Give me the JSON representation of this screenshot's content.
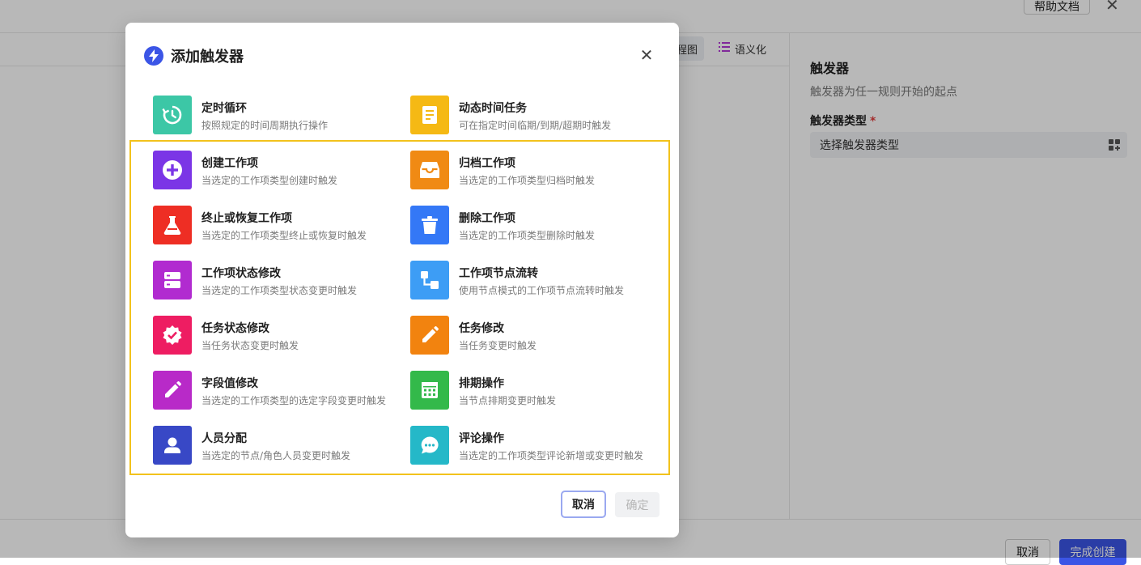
{
  "background": {
    "help_label": "帮助文档",
    "close_glyph": "✕",
    "tab_flow_label": "程图",
    "tab_semantic_label": "语义化",
    "panel": {
      "title": "触发器",
      "description": "触发器为任一规则开始的起点",
      "type_label": "触发器类型",
      "required_mark": "*",
      "type_placeholder": "选择触发器类型"
    },
    "footer": {
      "cancel_label": "取消",
      "finish_label": "完成创建"
    }
  },
  "modal": {
    "title": "添加触发器",
    "close_glyph": "✕",
    "triggers": [
      {
        "title": "定时循环",
        "desc": "按照规定的时间周期执行操作",
        "color": "#3cc7a6",
        "icon": "history-icon"
      },
      {
        "title": "动态时间任务",
        "desc": "可在指定时间临期/到期/超期时触发",
        "color": "#f5b914",
        "icon": "document-icon"
      },
      {
        "title": "创建工作项",
        "desc": "当选定的工作项类型创建时触发",
        "color": "#7b35e6",
        "icon": "plus-circle-icon"
      },
      {
        "title": "归档工作项",
        "desc": "当选定的工作项类型归档时触发",
        "color": "#f08a14",
        "icon": "inbox-icon"
      },
      {
        "title": "终止或恢复工作项",
        "desc": "当选定的工作项类型终止或恢复时触发",
        "color": "#ee2e24",
        "icon": "flask-icon"
      },
      {
        "title": "删除工作项",
        "desc": "当选定的工作项类型删除时触发",
        "color": "#3478f6",
        "icon": "trash-icon"
      },
      {
        "title": "工作项状态修改",
        "desc": "当选定的工作项类型状态变更时触发",
        "color": "#b12bd0",
        "icon": "server-icon"
      },
      {
        "title": "工作项节点流转",
        "desc": "使用节点模式的工作项节点流转时触发",
        "color": "#3d9df5",
        "icon": "flow-nodes-icon"
      },
      {
        "title": "任务状态修改",
        "desc": "当任务状态变更时触发",
        "color": "#ee1d62",
        "icon": "verified-badge-icon"
      },
      {
        "title": "任务修改",
        "desc": "当任务变更时触发",
        "color": "#f2830f",
        "icon": "pencil-icon"
      },
      {
        "title": "字段值修改",
        "desc": "当选定的工作项类型的选定字段变更时触发",
        "color": "#b82ac8",
        "icon": "edit-icon"
      },
      {
        "title": "排期操作",
        "desc": "当节点排期变更时触发",
        "color": "#33b94a",
        "icon": "calendar-icon"
      },
      {
        "title": "人员分配",
        "desc": "当选定的节点/角色人员变更时触发",
        "color": "#3848c6",
        "icon": "person-icon"
      },
      {
        "title": "评论操作",
        "desc": "当选定的工作项类型评论新增或变更时触发",
        "color": "#25b8c8",
        "icon": "comment-icon"
      }
    ],
    "cancel_label": "取消",
    "ok_label": "确定"
  }
}
